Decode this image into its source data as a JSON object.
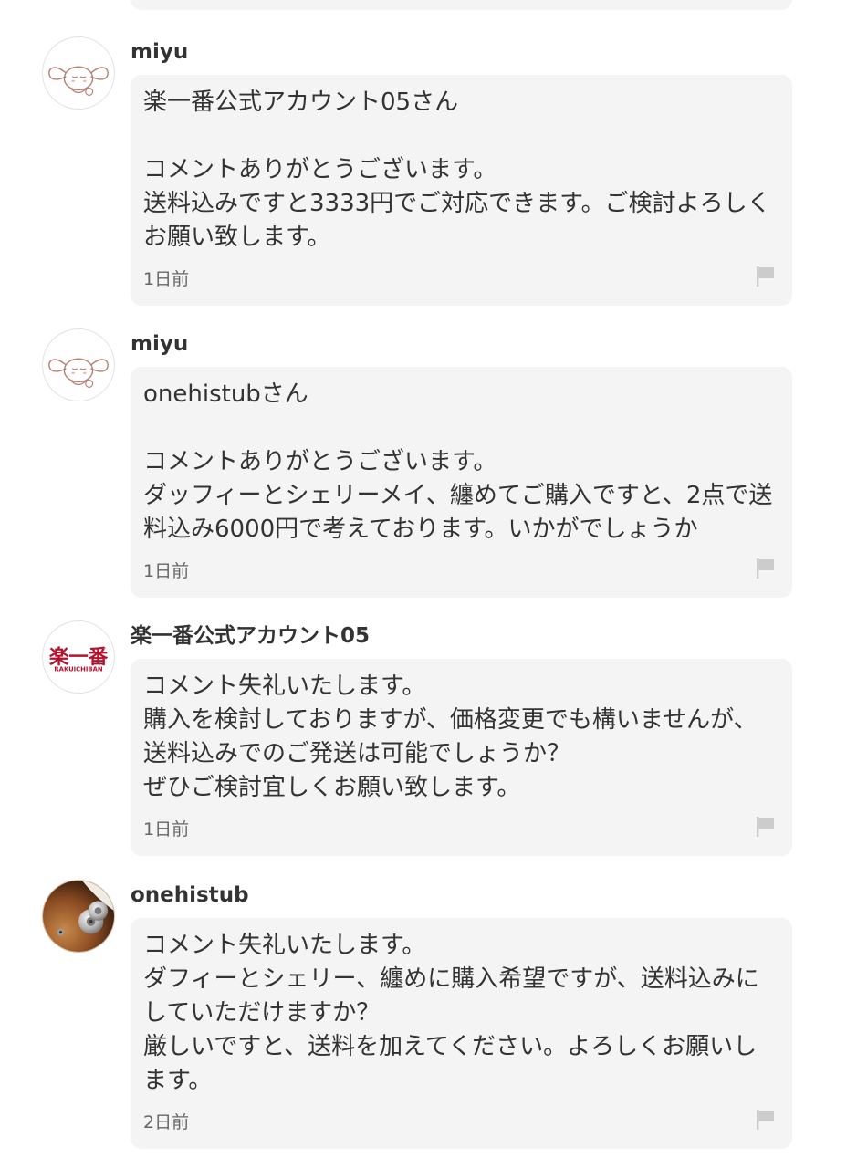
{
  "comments": [
    {
      "username": "miyu",
      "avatar": "cinnamoroll-avatar",
      "body": "楽一番公式アカウント05さん\n\nコメントありがとうございます。\n送料込みですと3333円でご対応できます。ご検討よろしくお願い致します。",
      "time": "1日前",
      "flag_icon": "flag-icon"
    },
    {
      "username": "miyu",
      "avatar": "cinnamoroll-avatar",
      "body": "onehistubさん\n\nコメントありがとうございます。\nダッフィーとシェリーメイ、纏めてご購入ですと、2点で送料込み6000円で考えております。いかがでしょうか",
      "time": "1日前",
      "flag_icon": "flag-icon"
    },
    {
      "username": "楽一番公式アカウント05",
      "avatar": "rakuichiban-logo-avatar",
      "avatar_logo_text": "楽一番",
      "avatar_logo_subtext": "RAKUICHIBAN",
      "body": "コメント失礼いたします。\n購入を検討しておりますが、価格変更でも構いませんが、送料込みでのご発送は可能でしょうか？\nぜひご検討宜しくお願い致します。",
      "time": "1日前",
      "flag_icon": "flag-icon"
    },
    {
      "username": "onehistub",
      "avatar": "photo-avatar",
      "body": "コメント失礼いたします。\nダフィーとシェリー、纏めに購入希望ですが、送料込みにしていただけますか？\n厳しいですと、送料を加えてください。よろしくお願いします。",
      "time": "2日前",
      "flag_icon": "flag-icon"
    }
  ],
  "colors": {
    "bubble_bg": "#f4f4f4",
    "text": "#333333",
    "meta": "#666666",
    "flag": "#cccccc",
    "logo_red": "#b5122e"
  }
}
